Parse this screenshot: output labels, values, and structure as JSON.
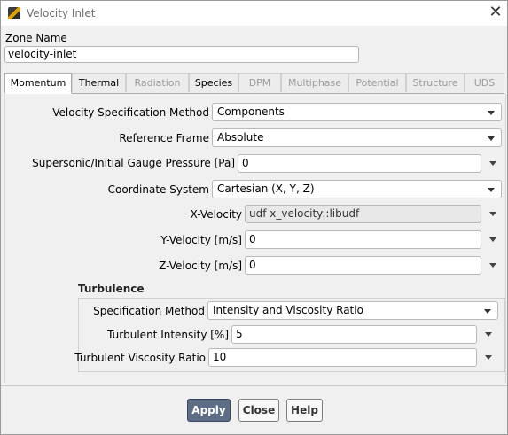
{
  "window": {
    "title": "Velocity Inlet",
    "close_symbol": "✕"
  },
  "zone": {
    "label": "Zone Name",
    "value": "velocity-inlet"
  },
  "tabs": [
    {
      "label": "Momentum",
      "active": true,
      "enabled": true
    },
    {
      "label": "Thermal",
      "active": false,
      "enabled": true
    },
    {
      "label": "Radiation",
      "active": false,
      "enabled": false
    },
    {
      "label": "Species",
      "active": false,
      "enabled": true
    },
    {
      "label": "DPM",
      "active": false,
      "enabled": false
    },
    {
      "label": "Multiphase",
      "active": false,
      "enabled": false
    },
    {
      "label": "Potential",
      "active": false,
      "enabled": false
    },
    {
      "label": "Structure",
      "active": false,
      "enabled": false
    },
    {
      "label": "UDS",
      "active": false,
      "enabled": false
    }
  ],
  "momentum": {
    "velocity_spec": {
      "label": "Velocity Specification Method",
      "value": "Components"
    },
    "reference_frame": {
      "label": "Reference Frame",
      "value": "Absolute"
    },
    "gauge_pressure": {
      "label": "Supersonic/Initial Gauge Pressure [Pa]",
      "value": "0"
    },
    "coordinate_system": {
      "label": "Coordinate System",
      "value": "Cartesian (X, Y, Z)"
    },
    "x_velocity": {
      "label": "X-Velocity",
      "value": "udf x_velocity::libudf"
    },
    "y_velocity": {
      "label": "Y-Velocity [m/s]",
      "value": "0"
    },
    "z_velocity": {
      "label": "Z-Velocity [m/s]",
      "value": "0"
    }
  },
  "turbulence": {
    "title": "Turbulence",
    "spec_method": {
      "label": "Specification Method",
      "value": "Intensity and Viscosity Ratio"
    },
    "intensity": {
      "label": "Turbulent Intensity [%]",
      "value": "5"
    },
    "viscosity_ratio": {
      "label": "Turbulent Viscosity Ratio",
      "value": "10"
    }
  },
  "buttons": {
    "apply": "Apply",
    "close": "Close",
    "help": "Help"
  },
  "colors": {
    "primary_button": "#5d6d85"
  }
}
